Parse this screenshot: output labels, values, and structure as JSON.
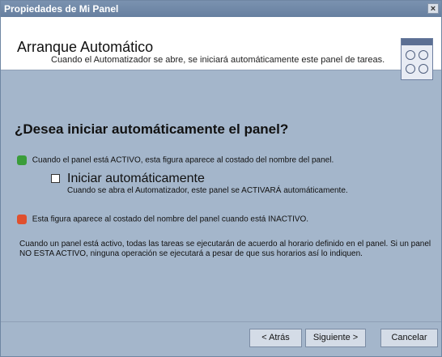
{
  "window": {
    "title": "Propiedades de Mi Panel",
    "close_label": "×"
  },
  "header": {
    "title": "Arranque Automático",
    "subtitle": "Cuando el Automatizador se abre, se iniciará automáticamente este panel de tareas."
  },
  "content": {
    "question": "¿Desea iniciar automáticamente el panel?",
    "active_text": "Cuando el panel está ACTIVO, esta figura aparece al costado del nombre del panel.",
    "checkbox_label": "Iniciar automáticamente",
    "checkbox_desc": "Cuando se abra el Automatizador, este panel se ACTIVARÁ automáticamente.",
    "inactive_text": "Esta figura aparece al costado del nombre del panel cuando está INACTIVO.",
    "note": "Cuando un panel está activo, todas las tareas se ejecutarán de acuerdo al horario definido en el panel. Si un panel NO ESTA ACTIVO, ninguna operación  se ejecutará a pesar de que sus horarios así lo indiquen.",
    "checkbox_checked": false
  },
  "buttons": {
    "back": "< Atrás",
    "next": "Siguiente >",
    "cancel": "Cancelar"
  },
  "colors": {
    "active": "#3a9d3a",
    "inactive": "#e0502e"
  }
}
